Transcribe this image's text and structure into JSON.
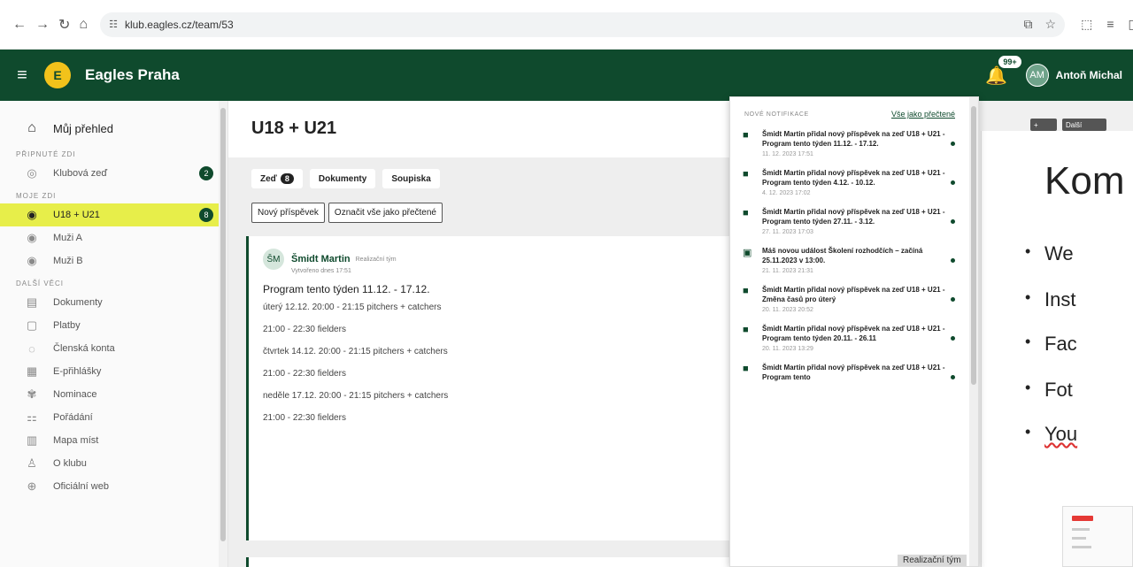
{
  "browser": {
    "url": "klub.eagles.cz/team/53"
  },
  "header": {
    "brand": "Eagles Praha",
    "notif_badge": "99+",
    "user_initials": "AM",
    "user_name": "Antoň Michal"
  },
  "sidebar": {
    "overview": "Můj přehled",
    "section_pinned": "PŘIPNUTÉ ZDI",
    "section_mine": "MOJE ZDI",
    "section_other": "DALŠÍ VĚCI",
    "pinned": [
      {
        "label": "Klubová zeď",
        "count": "2"
      }
    ],
    "walls": [
      {
        "label": "U18 + U21",
        "count": "8"
      },
      {
        "label": "Muži A"
      },
      {
        "label": "Muži B"
      }
    ],
    "other": [
      {
        "label": "Dokumenty"
      },
      {
        "label": "Platby"
      },
      {
        "label": "Členská konta"
      },
      {
        "label": "E-přihlášky"
      },
      {
        "label": "Nominace"
      },
      {
        "label": "Pořádání"
      },
      {
        "label": "Mapa míst"
      },
      {
        "label": "O klubu"
      },
      {
        "label": "Oficiální web"
      }
    ]
  },
  "main": {
    "title": "U18 + U21",
    "tabs": [
      {
        "label": "Zeď",
        "count": "8"
      },
      {
        "label": "Dokumenty"
      },
      {
        "label": "Soupiska"
      }
    ],
    "new_post": "Nový příspěvek",
    "mark_all": "Označit vše jako přečtené",
    "post": {
      "initials": "ŠM",
      "author": "Šmidt Martin",
      "role": "Realizační tým",
      "created": "Vytvořeno dnes 17:51",
      "title": "Program tento týden 11.12. - 17.12.",
      "lines": [
        "úterý 12.12. 20:00 - 21:15 pitchers + catchers",
        "21:00 - 22:30 fielders",
        "čtvrtek 14.12. 20:00 - 21:15 pitchers + catchers",
        "21:00 - 22:30 fielders",
        "neděle 17.12. 20:00 - 21:15 pitchers + catchers",
        "21:00 - 22:30 fielders"
      ]
    }
  },
  "notifications": {
    "label": "NOVÉ NOTIFIKACE",
    "mark_all": "Vše jako přečtené",
    "items": [
      {
        "icon": "chat-icon",
        "text": "Šmidt Martin přidal nový příspěvek na zeď U18 + U21 - Program tento týden 11.12. - 17.12.",
        "date": "11. 12. 2023 17:51"
      },
      {
        "icon": "chat-icon",
        "text": "Šmidt Martin přidal nový příspěvek na zeď U18 + U21 - Program tento týden 4.12. - 10.12.",
        "date": "4. 12. 2023 17:02"
      },
      {
        "icon": "chat-icon",
        "text": "Šmidt Martin přidal nový příspěvek na zeď U18 + U21 - Program tento týden 27.11. - 3.12.",
        "date": "27. 11. 2023 17:03"
      },
      {
        "icon": "calendar-icon",
        "text": "Máš novou událost Školení rozhodčích – začíná 25.11.2023 v 13:00.",
        "date": "21. 11. 2023 21:31"
      },
      {
        "icon": "chat-icon",
        "text": "Šmidt Martin přidal nový příspěvek na zeď U18 + U21 - Změna časů pro úterý",
        "date": "20. 11. 2023 20:52"
      },
      {
        "icon": "chat-icon",
        "text": "Šmidt Martin přidal nový příspěvek na zeď U18 + U21 - Program tento týden 20.11. - 26.11",
        "date": "20. 11. 2023 13:29"
      },
      {
        "icon": "chat-icon",
        "text": "Šmidt Martin přidal nový příspěvek na zeď U18 + U21 - Program tento",
        "date": ""
      }
    ]
  },
  "footer_tag": "Realizační tým",
  "slide": {
    "title": "Kom",
    "bullets": [
      "We",
      "Inst",
      "Fac",
      "Fot",
      "You"
    ],
    "top_button": "Další"
  },
  "colors": {
    "brand": "#0f4a2d",
    "highlight": "#e7ee4a"
  }
}
